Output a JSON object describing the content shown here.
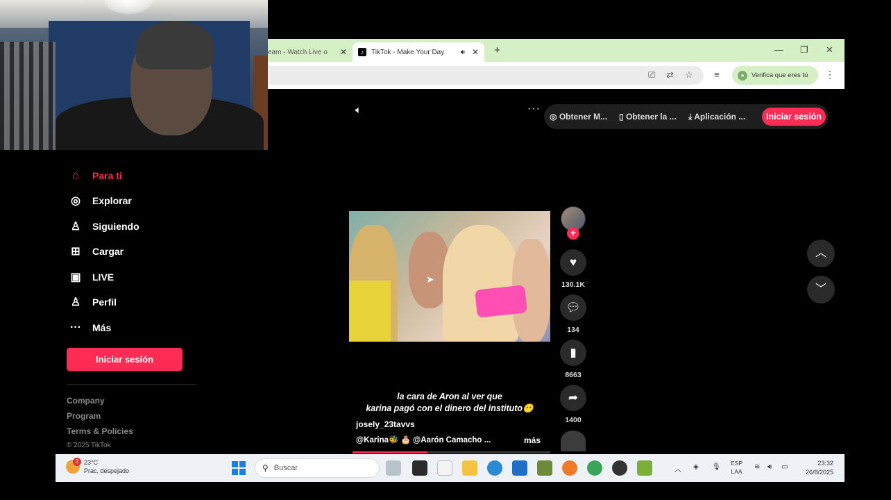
{
  "browser": {
    "tabs": [
      {
        "title": "eam - Watch Live o",
        "active": false
      },
      {
        "title": "TikTok - Make Your Day",
        "active": true
      }
    ],
    "verify_label": "Verifica que eres tú"
  },
  "tiktok": {
    "top_bar": {
      "get_mode": "Obtener M...",
      "get_app": "Obtener la ...",
      "application": "Aplicación ...",
      "login": "Iniciar sesión"
    },
    "sidebar": {
      "items": [
        {
          "label": "Para ti",
          "icon": "home-icon",
          "active": true
        },
        {
          "label": "Explorar",
          "icon": "compass-icon"
        },
        {
          "label": "Siguiendo",
          "icon": "following-icon"
        },
        {
          "label": "Cargar",
          "icon": "upload-icon"
        },
        {
          "label": "LIVE",
          "icon": "live-icon"
        },
        {
          "label": "Perfil",
          "icon": "profile-icon"
        },
        {
          "label": "Más",
          "icon": "more-icon"
        }
      ],
      "login": "Iniciar sesión",
      "footer": {
        "company": "Company",
        "program": "Program",
        "terms": "Terms & Policies",
        "copyright": "© 2025 TikTok"
      }
    },
    "video": {
      "caption_line1": "la cara de Aron al ver que",
      "caption_line2": "karina pagó con el dinero del instituto😶",
      "author": "josely_23tavvs",
      "mentions": "@Karina🐝 🎂 @Aarón Camacho ...",
      "more": "más",
      "likes": "130.1K",
      "comments": "134",
      "saves": "8663",
      "shares": "1400",
      "progress": 0.38
    }
  },
  "taskbar": {
    "weather_temp": "23°C",
    "weather_desc": "Prac. despejado",
    "weather_badge": "2",
    "search_placeholder": "Buscar",
    "lang_line1": "ESP",
    "lang_line2": "LAA",
    "time": "23:32",
    "date": "26/8/2025"
  }
}
